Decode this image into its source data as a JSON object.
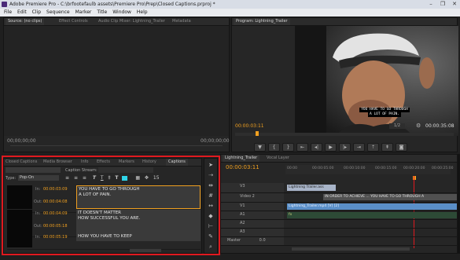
{
  "window": {
    "title": "Adobe Premiere Pro - C:\\brfootefaulb assets\\Premiere Pro\\Prep\\Closed Captions.prproj *",
    "controls": [
      "–",
      "❐",
      "✕"
    ]
  },
  "menu": [
    "File",
    "Edit",
    "Clip",
    "Sequence",
    "Marker",
    "Title",
    "Window",
    "Help"
  ],
  "source_panel": {
    "tabs": [
      "Source: (no clips)",
      "Effect Controls",
      "Audio Clip Mixer: Lightning_Trailer",
      "Metadata"
    ],
    "timecode_left": "00;00;00;00",
    "timecode_right": "00;00;00;00"
  },
  "program_panel": {
    "tab": "Program: Lightning_Trailer",
    "caption_line1": "YOU HAVE TO GO THROUGH",
    "caption_line2": "A LOT OF PAIN.",
    "timecode_current": "00:00:03:11",
    "zoom": "1/2",
    "timecode_duration": "00:00:35:08"
  },
  "captions_panel": {
    "tabs": [
      "Closed Captions",
      "Media Browser",
      "Info",
      "Effects",
      "Markers",
      "History",
      "Captions"
    ],
    "search_value": "",
    "caption_stream_label": "Caption Stream:",
    "type_label": "Type:",
    "type_value": "Pop-On",
    "position_value": "15",
    "rows": [
      {
        "in_label": "In:",
        "in": "00:00:03:09",
        "out_label": "Out:",
        "out": "00:00:04:08",
        "text1": "YOU HAVE TO GO THROUGH",
        "text2": "A LOT OF PAIN."
      },
      {
        "in_label": "In:",
        "in": "00:00:04:09",
        "out_label": "Out:",
        "out": "00:00:05:18",
        "text1": "IT DOESN'T MATTER",
        "text2": "HOW SUCCESSFUL YOU ARE."
      },
      {
        "in_label": "In:",
        "in": "00:00:05:19",
        "out_label": "Out:",
        "out": "",
        "text1": "HOW YOU HAVE TO KEEP",
        "text2": ""
      }
    ]
  },
  "timeline_panel": {
    "tabs": [
      "Lightning_Trailer",
      "Vocal Layer"
    ],
    "timecode": "00:00:03:11",
    "ruler": [
      "00:00",
      "00:00:05:00",
      "00:00:10:00",
      "00:00:15:00",
      "00:00:20:00",
      "00:00:25:00"
    ],
    "tracks": [
      {
        "name": "V3",
        "clip": "Lightning Trailer.ass"
      },
      {
        "name": "Video 2",
        "clip": "IN ORDER TO ACHIEVE ...   YOU HAVE TO GO THROUGH   A"
      },
      {
        "name": "V1",
        "clip": "Lightning_Trailer.mp4 [V] [2]"
      },
      {
        "name": "A1",
        "clip": "fx"
      },
      {
        "name": "A2",
        "clip": ""
      },
      {
        "name": "A3",
        "clip": ""
      },
      {
        "name": "Master",
        "clip": ""
      }
    ],
    "master_value": "0.0"
  },
  "colors": {
    "accent_orange": "#f0a020",
    "highlight_red": "#e0191f",
    "clip_blue": "#5a8fc8",
    "clip_lightblue": "#a8c8ea"
  }
}
